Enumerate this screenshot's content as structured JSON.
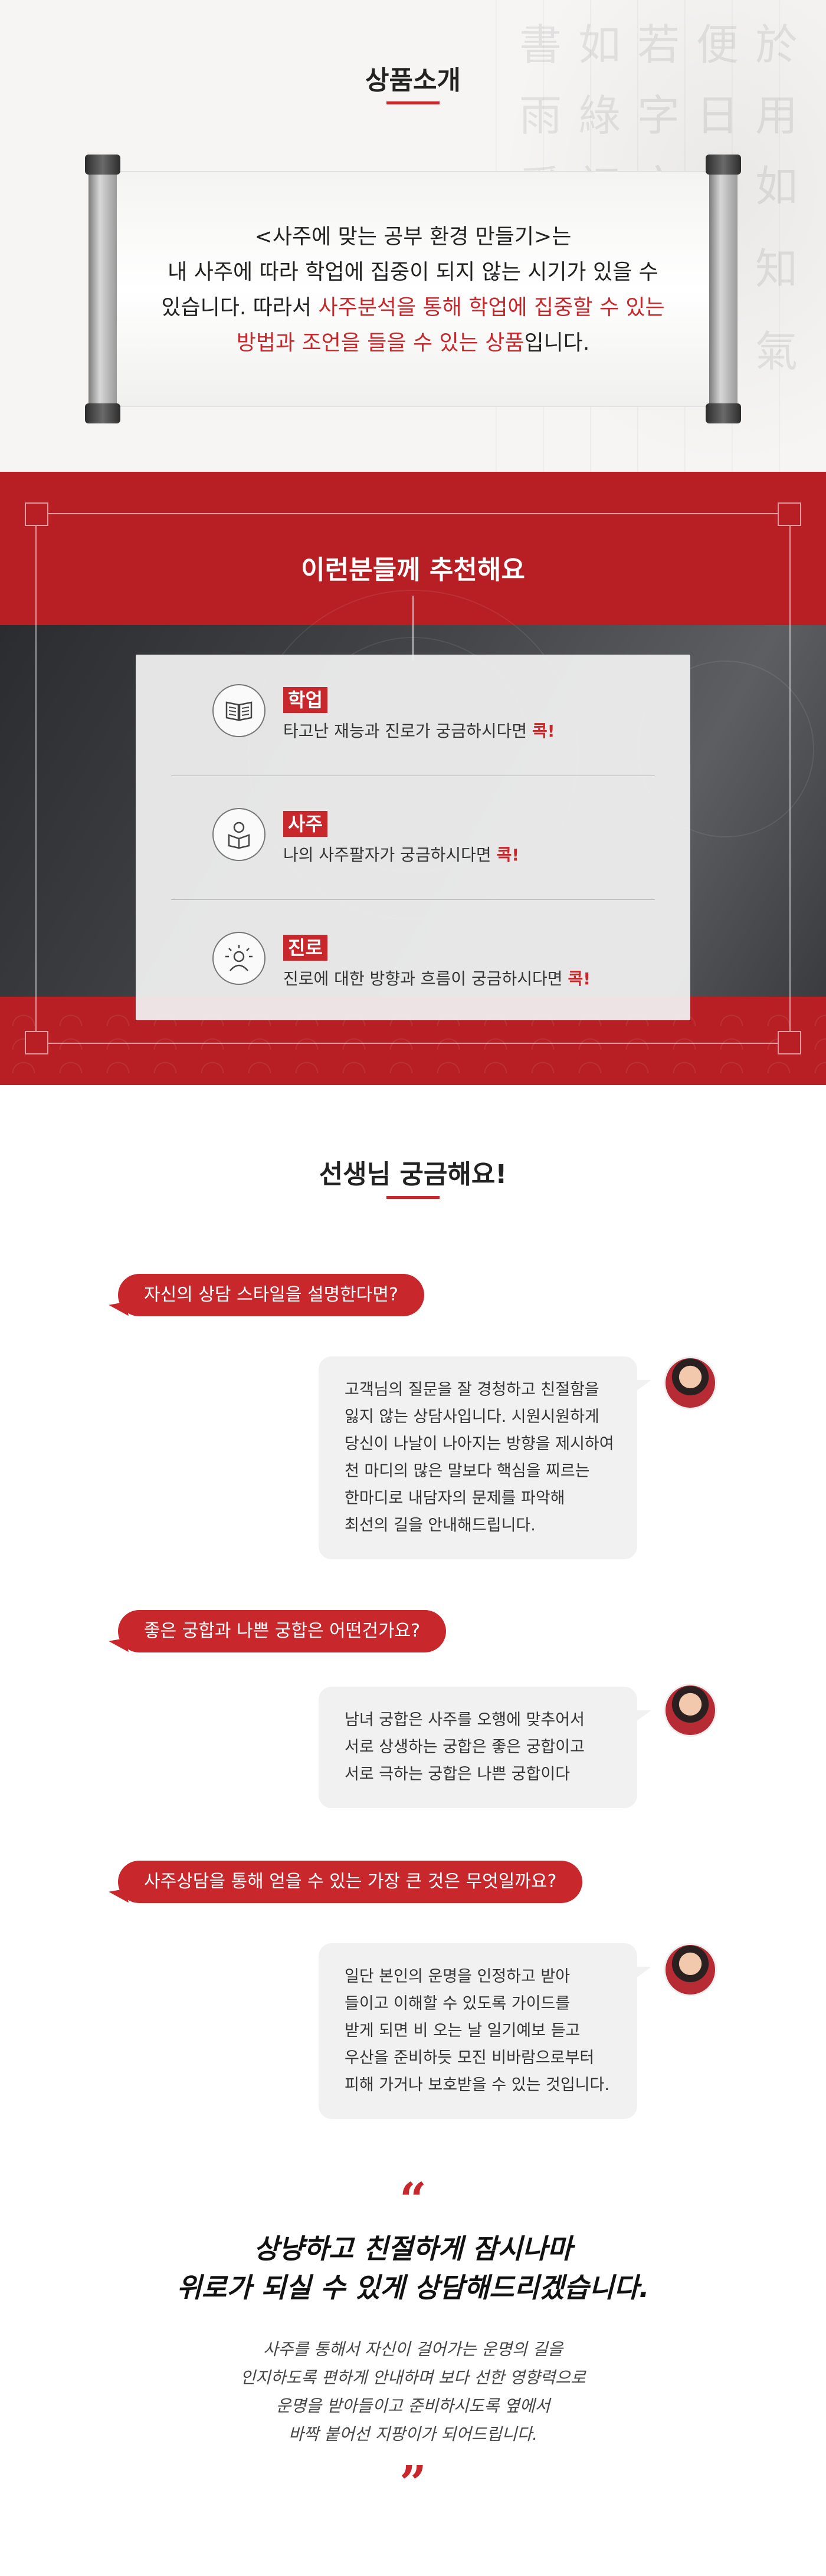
{
  "intro": {
    "title": "상품소개",
    "line1": "<사주에 맞는 공부 환경 만들기>는",
    "line2": "내 사주에 따라 학업에 집중이 되지 않는 시기가 있을 수",
    "line3_a": "있습니다. 따라서 ",
    "line3_b": "사주분석을 통해 학업에 집중할 수 있는",
    "line4_a": "방법과 조언을 들을 수 있는 상품",
    "line4_b": "입니다."
  },
  "recommend": {
    "title": "이런분들께 추천해요",
    "items": [
      {
        "tag": "학업",
        "desc": "타고난 재능과 진로가 궁금하시다면 ",
        "emph": "콕!",
        "icon": "book-icon"
      },
      {
        "tag": "사주",
        "desc": "나의 사주팔자가 궁금하시다면 ",
        "emph": "콕!",
        "icon": "reading-person-icon"
      },
      {
        "tag": "진로",
        "desc": "진로에 대한 방향과 흐름이 궁금하시다면 ",
        "emph": "콕!",
        "icon": "idea-person-icon"
      }
    ]
  },
  "qa": {
    "title": "선생님 궁금해요!",
    "items": [
      {
        "q": "자신의 상담 스타일을 설명한다면?",
        "a": [
          "고객님의 질문을 잘 경청하고 친절함을",
          "잃지 않는 상담사입니다. 시원시원하게",
          "당신이 나날이 나아지는 방향을 제시하여",
          "천 마디의 많은 말보다 핵심을 찌르는",
          "한마디로 내담자의 문제를 파악해",
          "최선의 길을 안내해드립니다."
        ]
      },
      {
        "q": "좋은 궁합과 나쁜 궁합은 어떤건가요?",
        "a": [
          "남녀 궁합은 사주를 오행에 맞추어서",
          "서로 상생하는 궁합은 좋은 궁합이고",
          "서로 극하는 궁합은 나쁜 궁합이다"
        ]
      },
      {
        "q": "사주상담을 통해 얻을 수 있는 가장 큰 것은 무엇일까요?",
        "a": [
          "일단 본인의 운명을 인정하고 받아",
          "들이고 이해할 수 있도록 가이드를",
          "받게 되면 비 오는 날 일기예보 듣고",
          "우산을 준비하듯 모진 비바람으로부터",
          "피해 가거나 보호받을 수 있는 것입니다."
        ]
      }
    ]
  },
  "closing": {
    "open_quote": "“",
    "close_quote": "”",
    "title1": "상냥하고 친절하게 잠시나마",
    "title2": "위로가 되실 수 있게 상담해드리겠습니다.",
    "body": [
      "사주를 통해서 자신이 걸어가는 운명의 길을",
      "인지하도록 편하게 안내하며 보다 선한 영향력으로",
      "운명을 받아들이고 준비하시도록 옆에서",
      "바짝 붙어선 지팡이가 되어드립니다."
    ]
  },
  "colors": {
    "accent": "#c8272c",
    "section_red": "#b71f24",
    "bubble": "#f1f1f1"
  }
}
